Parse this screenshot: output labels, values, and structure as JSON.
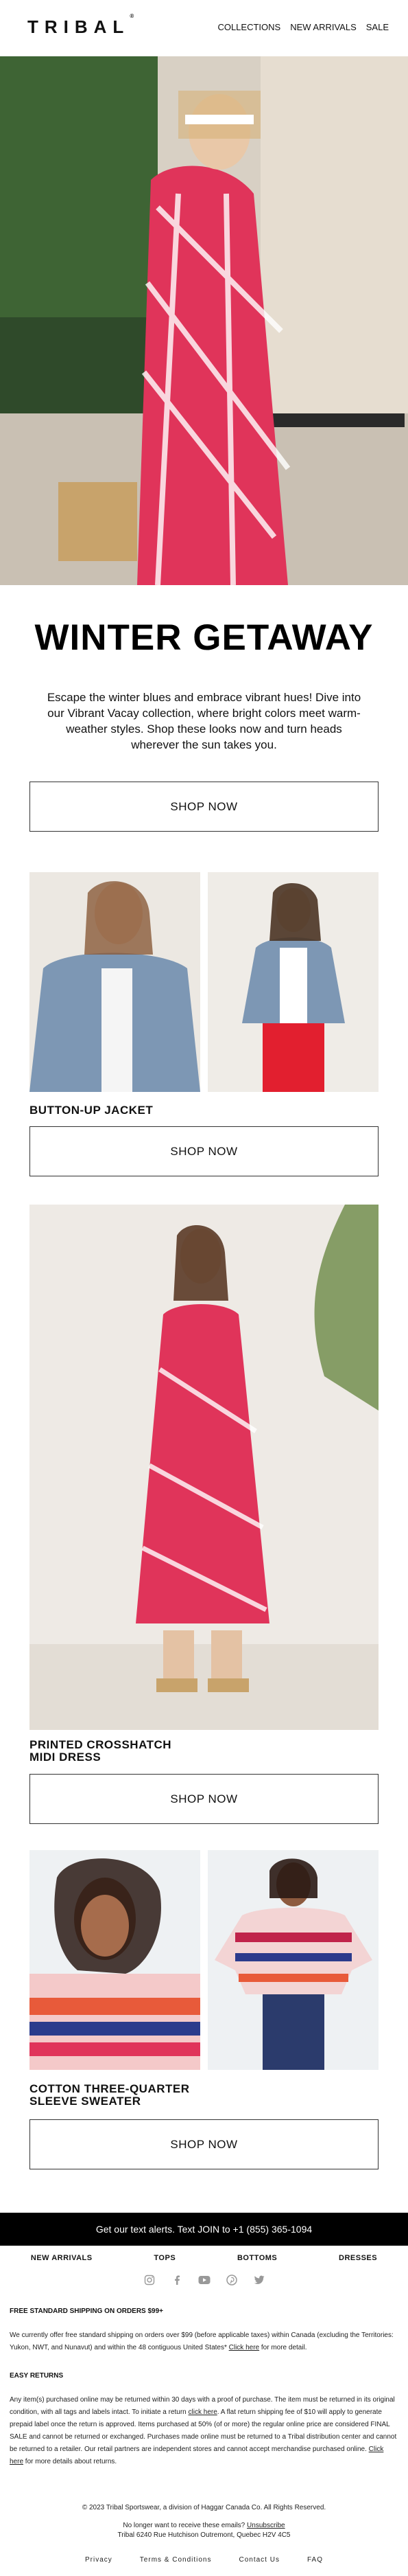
{
  "brand": {
    "name": "TRIBAL",
    "mark": "®"
  },
  "nav": {
    "collections": "COLLECTIONS",
    "new_arrivals": "NEW ARRIVALS",
    "sale": "SALE"
  },
  "hero": {
    "title": "WINTER GETAWAY",
    "intro": "Escape the winter blues and embrace vibrant hues! Dive into our Vibrant Vacay collection, where bright colors meet warm-weather styles. Shop these looks now and turn heads wherever the sun takes you.",
    "cta": "SHOP NOW"
  },
  "products": [
    {
      "label": "BUTTON-UP JACKET",
      "cta": "SHOP NOW"
    },
    {
      "label": "PRINTED CROSSHATCH MIDI DRESS",
      "cta": "SHOP NOW"
    },
    {
      "label": "COTTON THREE-QUARTER SLEEVE SWEATER",
      "cta": "SHOP NOW"
    }
  ],
  "alert": {
    "text": "Get our text alerts. Text JOIN to +1 (855) 365-1094"
  },
  "footer_nav": [
    "NEW ARRIVALS",
    "TOPS",
    "BOTTOMS",
    "DRESSES"
  ],
  "social_icons": [
    "instagram-icon",
    "facebook-icon",
    "youtube-icon",
    "pinterest-icon",
    "twitter-icon"
  ],
  "shipping": {
    "heading": "FREE STANDARD SHIPPING ON ORDERS $99+",
    "text_before": "We currently offer free standard shipping on orders over $99 (before applicable taxes) within Canada (excluding the Territories: Yukon, NWT, and Nunavut) and within the 48 contiguous United States*",
    "link": "Click here",
    "text_after": "for more detail."
  },
  "returns": {
    "heading": "EASY RETURNS",
    "text1": "Any item(s) purchased online may be returned within 30 days with a proof of purchase. The item must be returned in its original condition, with all tags and labels intact. To initiate a return",
    "link1": "click here",
    "text2": ". A flat return shipping fee of $10 will apply to generate prepaid label once the return is approved. Items purchased at 50% (of or more) the regular online price are considered FINAL SALE and cannot be returned or exchanged. Purchases made online must be returned to a Tribal distribution center and cannot be returned to a retailer. Our retail partners are independent stores and cannot accept merchandise purchased online.",
    "link2": "Click here",
    "text3": "for more details about returns."
  },
  "legal": {
    "copyright": "© 2023 Tribal Sportswear, a division of Haggar Canada Co. All Rights Reserved.",
    "unsubscribe_pre": "No longer want to receive these emails?",
    "unsubscribe_link": "Unsubscribe",
    "address": "Tribal 6240 Rue Hutchison Outremont, Quebec H2V 4C5"
  },
  "bottom_links": [
    "Privacy",
    "Terms & Conditions",
    "Contact Us",
    "FAQ"
  ]
}
